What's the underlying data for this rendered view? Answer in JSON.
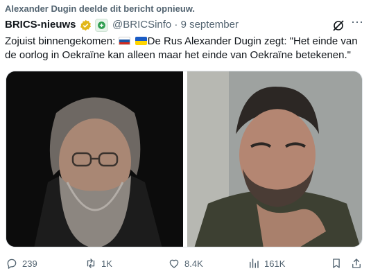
{
  "repost_banner": "Alexander Dugin deelde dit bericht opnieuw.",
  "author": {
    "display_name": "BRICS-nieuws",
    "handle_time": "@BRICSinfo · 9 september"
  },
  "tweet": {
    "text_before_flags": "Zojuist binnengekomen: ",
    "flag_icons": [
      "flag-russia-icon",
      "flag-ukraine-icon"
    ],
    "text_after_flags": "De Rus Alexander Dugin zegt: \"Het einde van de oorlog in Oekraïne kan alleen maar het einde van Oekraïne betekenen.\""
  },
  "media": [
    {
      "alt": "photo-left"
    },
    {
      "alt": "photo-right"
    }
  ],
  "actions": {
    "reply_count": "239",
    "repost_count": "1K",
    "like_count": "8.4K",
    "view_count": "161K"
  },
  "colors": {
    "text_primary": "#0f1419",
    "text_secondary": "#536471",
    "verified_gold": "#e2b719",
    "border": "#e1e6ea"
  }
}
